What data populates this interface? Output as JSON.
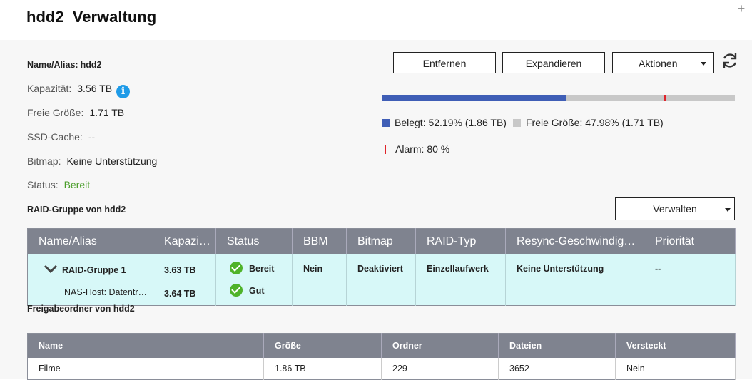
{
  "window": {
    "title": "hdd2  Verwaltung",
    "plus_icon": "+"
  },
  "info": {
    "name_label": "Name/Alias:",
    "name_value": "hdd2",
    "capacity_label": "Kapazität:",
    "capacity_value": "3.56 TB",
    "info_icon": "i",
    "free_label": "Freie Größe:",
    "free_value": "1.71 TB",
    "ssd_label": "SSD-Cache:",
    "ssd_value": "--",
    "bitmap_label": "Bitmap:",
    "bitmap_value": "Keine Unterstützung",
    "status_label": "Status:",
    "status_value": "Bereit"
  },
  "actions": {
    "remove_label": "Entfernen",
    "expand_label": "Expandieren",
    "actions_label": "Aktionen"
  },
  "usage": {
    "used_fraction": 0.5219,
    "alarm_fraction": 0.8,
    "used_text": "Belegt: 52.19% (1.86 TB)",
    "free_text": "Freie Größe: 47.98% (1.71 TB)",
    "alarm_text": "Alarm: 80 %",
    "colors": {
      "used": "#3f5eb6",
      "free": "#c8c8c8",
      "alarm": "#e0242b"
    }
  },
  "raid_section": {
    "title": "RAID-Gruppe von hdd2",
    "manage_label": "Verwalten",
    "columns": [
      "Name/Alias",
      "Kapazi…",
      "Status",
      "BBM",
      "Bitmap",
      "RAID-Typ",
      "Resync-Geschwindig…",
      "Priorität"
    ],
    "group": {
      "name": "RAID-Gruppe 1",
      "capacity": "3.63 TB",
      "status": "Bereit",
      "bbm": "Nein",
      "bitmap": "Deaktiviert",
      "raid_type": "Einzellaufwerk",
      "resync": "Keine Unterstützung",
      "priority": "--"
    },
    "disk": {
      "name": "NAS-Host: Datentr…",
      "capacity": "3.64 TB",
      "status": "Gut"
    }
  },
  "share_section": {
    "title": "Freigabeordner von hdd2",
    "columns": [
      "Name",
      "Größe",
      "Ordner",
      "Dateien",
      "Versteckt"
    ],
    "rows": [
      {
        "name": "Filme",
        "size": "1.86 TB",
        "folders": "229",
        "files": "3652",
        "hidden": "Nein"
      }
    ]
  }
}
